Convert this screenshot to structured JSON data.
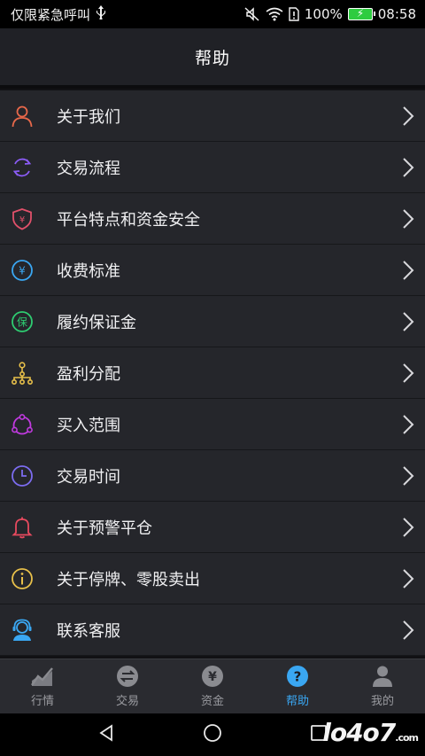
{
  "status_bar": {
    "left_text": "仅限紧急呼叫",
    "usb_icon": "usb-icon",
    "battery": "100%",
    "time": "08:58"
  },
  "header": {
    "title": "帮助"
  },
  "menu": [
    {
      "label": "关于我们",
      "icon": "person-icon",
      "color": "#e8684a"
    },
    {
      "label": "交易流程",
      "icon": "refresh-cycle-icon",
      "color": "#8b5cf6"
    },
    {
      "label": "平台特点和资金安全",
      "icon": "shield-icon",
      "color": "#e0506a"
    },
    {
      "label": "收费标准",
      "icon": "yen-circle-icon",
      "color": "#3aa7f2"
    },
    {
      "label": "履约保证金",
      "icon": "guarantee-icon",
      "color": "#2ecc71"
    },
    {
      "label": "盈利分配",
      "icon": "hierarchy-icon",
      "color": "#e8c04a"
    },
    {
      "label": "买入范围",
      "icon": "range-icon",
      "color": "#c03adf"
    },
    {
      "label": "交易时间",
      "icon": "clock-icon",
      "color": "#7c6cf0"
    },
    {
      "label": "关于预警平仓",
      "icon": "bell-icon",
      "color": "#e84a5f"
    },
    {
      "label": "关于停牌、零股卖出",
      "icon": "info-icon",
      "color": "#e8c04a"
    },
    {
      "label": "联系客服",
      "icon": "headset-icon",
      "color": "#3aa7f2"
    }
  ],
  "guarantee_glyph": "保",
  "yen_glyph": "¥",
  "tabs": [
    {
      "label": "行情",
      "icon": "chart-icon",
      "active": false
    },
    {
      "label": "交易",
      "icon": "exchange-icon",
      "active": false
    },
    {
      "label": "资金",
      "icon": "yen-icon",
      "active": false
    },
    {
      "label": "帮助",
      "icon": "help-icon",
      "active": true
    },
    {
      "label": "我的",
      "icon": "user-icon",
      "active": false
    }
  ],
  "watermark": {
    "main": "lo4o7",
    "suffix": ".com"
  }
}
